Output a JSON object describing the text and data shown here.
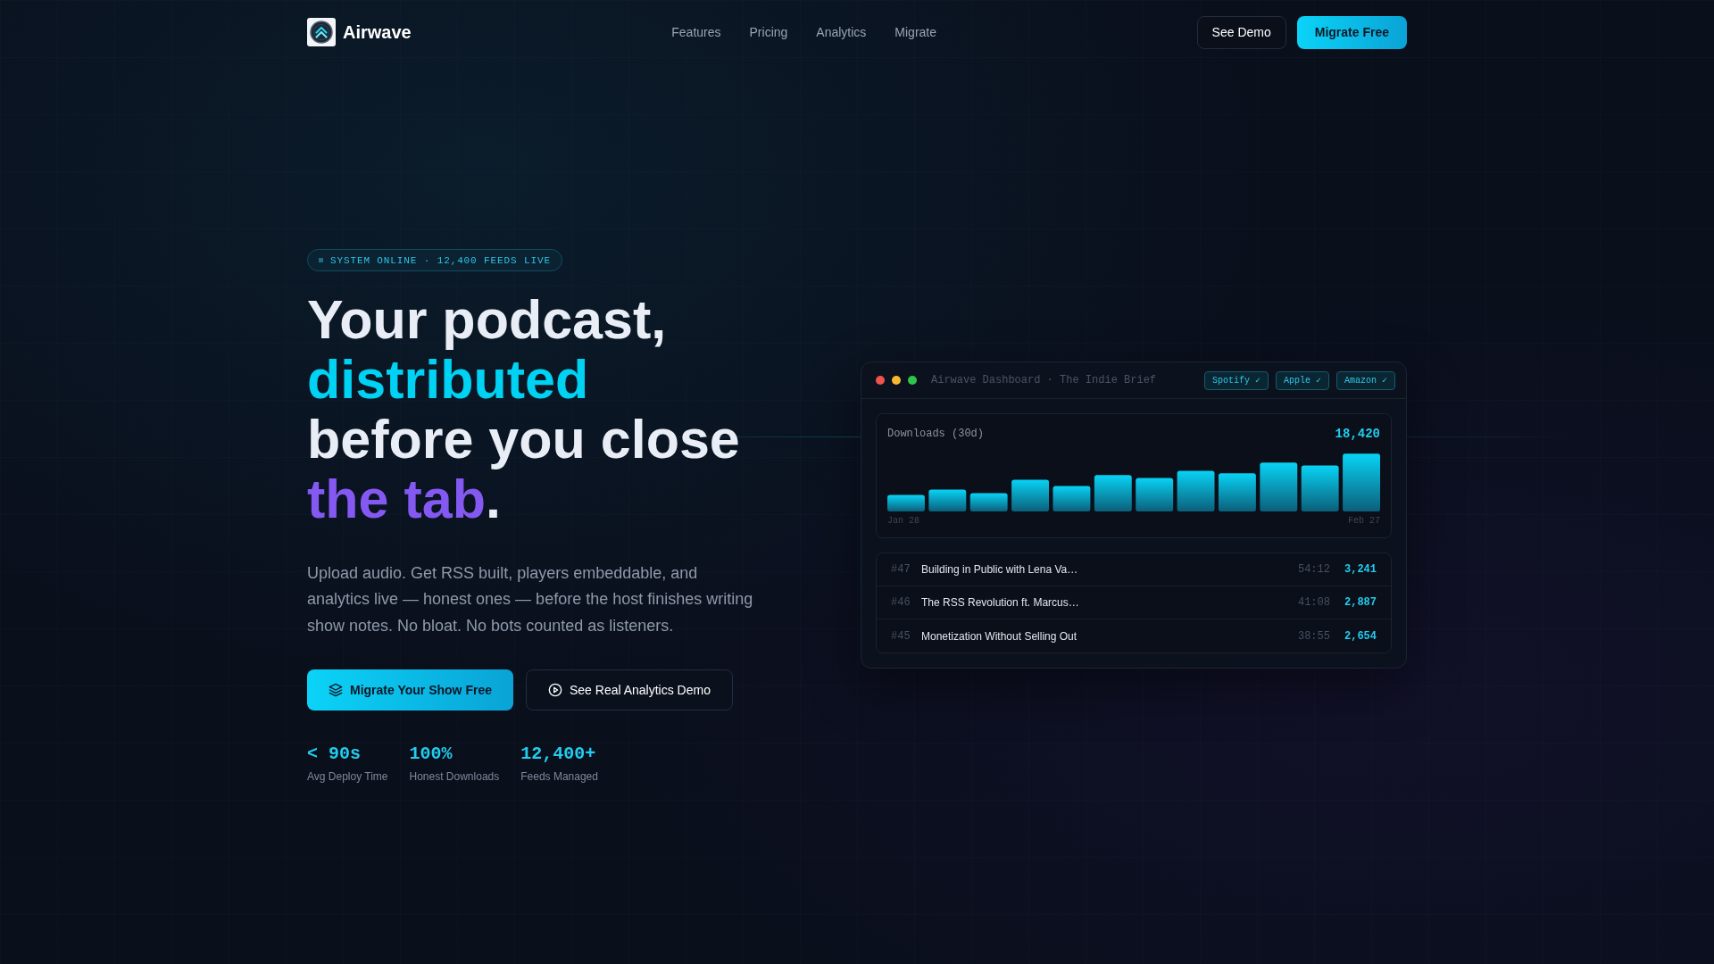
{
  "nav": {
    "brand": "Airwave",
    "links": [
      "Features",
      "Pricing",
      "Analytics",
      "Migrate"
    ],
    "buttons": [
      {
        "label": "See Demo",
        "kind": "secondary"
      },
      {
        "label": "Migrate Free",
        "kind": "primary"
      }
    ]
  },
  "hero": {
    "badge": "SYSTEM ONLINE · 12,400 FEEDS LIVE",
    "headline": [
      [
        {
          "text": "Your podcast,",
          "kind": "plain"
        }
      ],
      [
        {
          "text": "distributed",
          "kind": "accent"
        }
      ],
      [
        {
          "text": "before you close",
          "kind": "plain"
        }
      ],
      [
        {
          "text": "the tab",
          "kind": "highlight"
        },
        {
          "text": ".",
          "kind": "plain"
        }
      ]
    ],
    "description": "Upload audio. Get RSS built, players embeddable, and analytics live — honest ones — before the host finishes writing show notes. No bloat. No bots counted as listeners.",
    "buttons": [
      {
        "label": "Migrate Your Show Free",
        "kind": "primary"
      },
      {
        "label": "See Real Analytics Demo",
        "kind": "secondary"
      }
    ],
    "stats": [
      {
        "value": "< 90s",
        "label": "Avg Deploy Time"
      },
      {
        "value": "100%",
        "label": "Honest Downloads"
      },
      {
        "value": "12,400+",
        "label": "Feeds Managed"
      }
    ]
  },
  "dashboard": {
    "title": "Airwave Dashboard · The Indie Brief",
    "platforms": [
      "Spotify ✓",
      "Apple ✓",
      "Amazon ✓"
    ],
    "downloads": {
      "label": "Downloads (30d)",
      "total": "18,420",
      "start_date": "Jan 28",
      "end_date": "Feb 27"
    },
    "episodes": [
      {
        "number": "#47",
        "title": "Building in Public with Lena Va…",
        "duration": "54:12",
        "downloads": "3,241"
      },
      {
        "number": "#46",
        "title": "The RSS Revolution ft. Marcus…",
        "duration": "41:08",
        "downloads": "2,887"
      },
      {
        "number": "#45",
        "title": "Monetization Without Selling Out",
        "duration": "38:55",
        "downloads": "2,654"
      }
    ]
  }
}
